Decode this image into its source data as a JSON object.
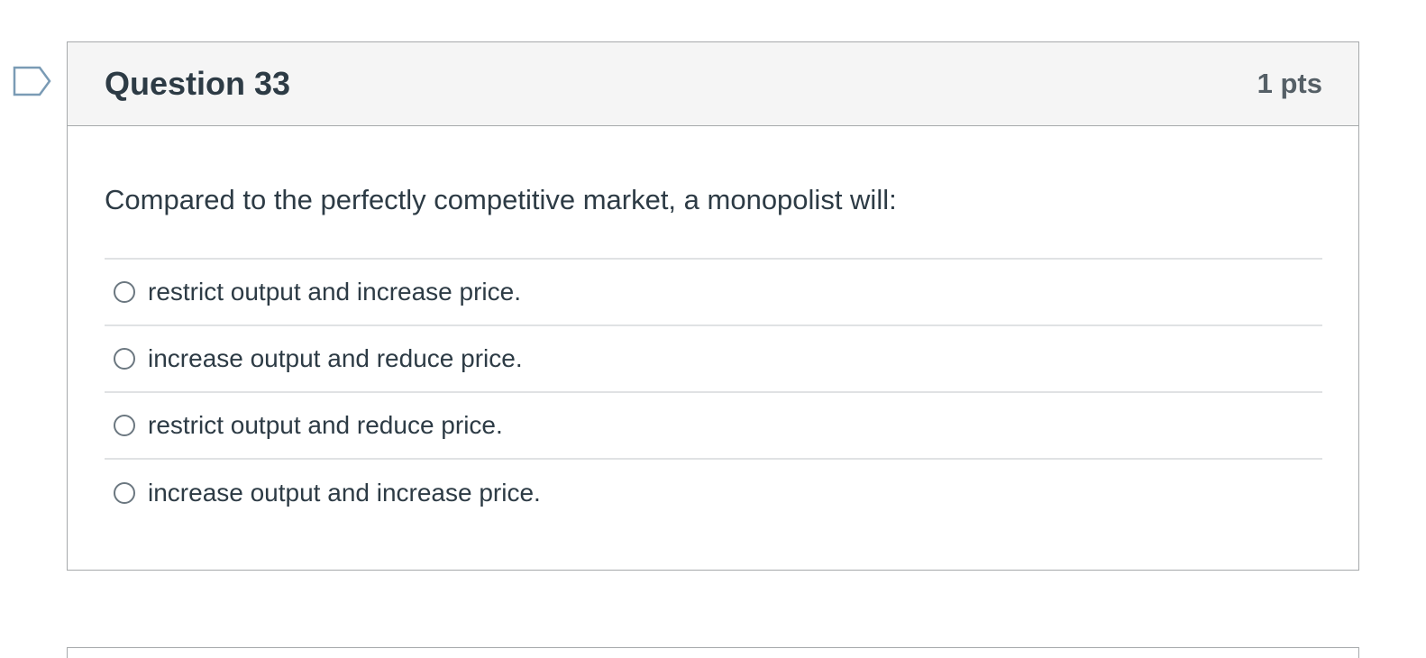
{
  "question": {
    "title": "Question 33",
    "points": "1 pts",
    "text": "Compared to the perfectly competitive market, a monopolist will:",
    "flag_icon": "flag-outline-icon",
    "answers": [
      {
        "label": "restrict output and increase price.",
        "selected": false
      },
      {
        "label": "increase output and reduce price.",
        "selected": false
      },
      {
        "label": "restrict output and reduce price.",
        "selected": false
      },
      {
        "label": "increase output and increase price.",
        "selected": false
      }
    ]
  },
  "colors": {
    "text": "#2d3b45",
    "header_bg": "#f5f5f5",
    "border": "#a6a9ab",
    "flag": "#7a9bb5"
  }
}
